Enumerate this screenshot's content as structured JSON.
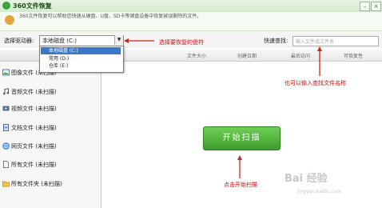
{
  "window": {
    "title": "360文件恢复",
    "info": "360文件恢复可以帮助您快速从硬盘、U盘、SD卡等储盘设备中恢复被误删除的文件。"
  },
  "drive": {
    "label": "选择驱动器:",
    "selected": "本地磁盘 (C:)",
    "options": [
      "本地磁盘 (C:)",
      "常用 (D:)",
      "仓库 (E:)"
    ]
  },
  "search": {
    "label": "快速查找:",
    "placeholder": "输入文件或文件名"
  },
  "sidebar": {
    "header": "分类",
    "items": [
      {
        "label": "图像文件 (未扫描)",
        "icon": "image-icon"
      },
      {
        "label": "音频文件 (未扫描)",
        "icon": "music-icon"
      },
      {
        "label": "视频文件 (未扫描)",
        "icon": "video-icon"
      },
      {
        "label": "文档文件 (未扫描)",
        "icon": "document-icon"
      },
      {
        "label": "网页文件 (未扫描)",
        "icon": "webpage-icon"
      },
      {
        "label": "所有文件 (未扫描)",
        "icon": "file-icon"
      },
      {
        "label": "所有文件夹 (未扫描)",
        "icon": "folder-icon"
      }
    ]
  },
  "columns": [
    "文件大小",
    "创建日期",
    "最后访问",
    "可恢复性"
  ],
  "main": {
    "scan_button": "开始扫描"
  },
  "annotations": {
    "choose_drive": "选择要恢复的盘符",
    "search_hint": "也可以输入查找文件名称",
    "scan_hint": "点击开始扫描",
    "color": "#cc1111"
  },
  "watermark": {
    "text": "Bai 经验",
    "sub": "jingyan.baidu.com"
  }
}
